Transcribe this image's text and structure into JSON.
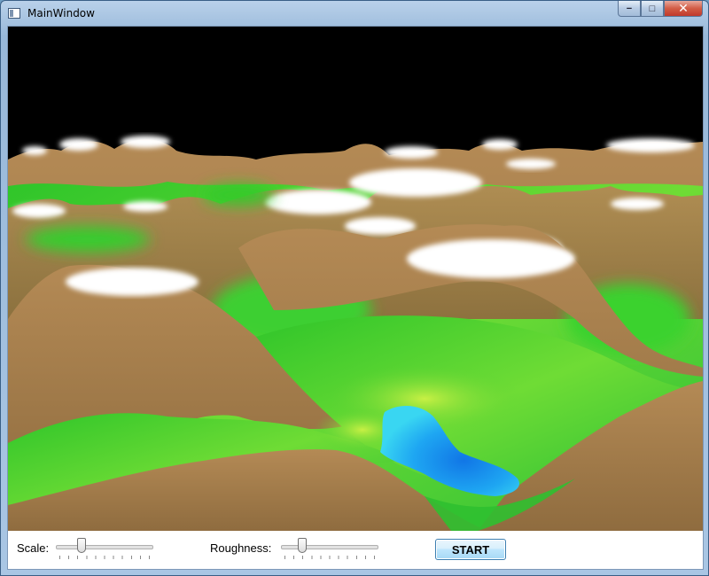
{
  "window": {
    "title": "MainWindow",
    "caption_minimize": "−",
    "caption_maximize": "□",
    "caption_close": "✕"
  },
  "viewport": {
    "description_icon": "terrain-3d-render",
    "colors": {
      "sky": "#000000",
      "mountain": "#a27c4b",
      "grass": "#31c92b",
      "light_grass": "#9ee43a",
      "snow": "#ffffff",
      "water": "#1e8ef0"
    }
  },
  "controls": {
    "scale_label": "Scale:",
    "scale_value": 0.25,
    "roughness_label": "Roughness:",
    "roughness_value": 0.2,
    "start_label": "START"
  }
}
